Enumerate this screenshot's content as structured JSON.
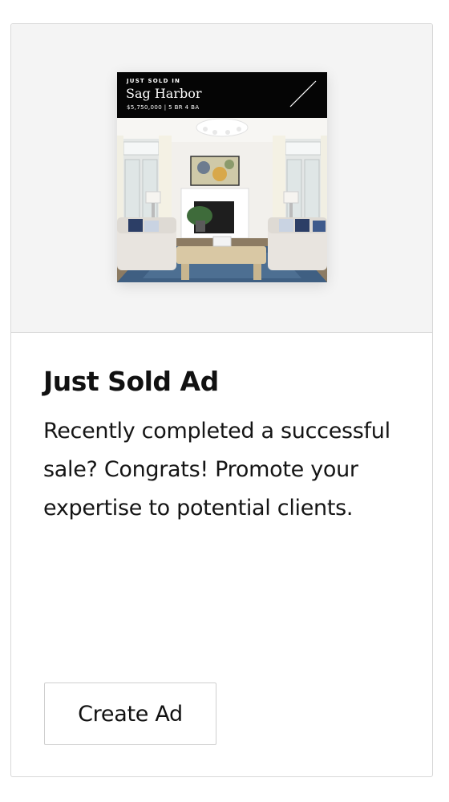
{
  "ad_preview": {
    "eyebrow": "JUST SOLD IN",
    "city": "Sag Harbor",
    "details": "$5,750,000 | 5 BR 4 BA"
  },
  "card": {
    "title": "Just Sold Ad",
    "description": "Recently completed a successful sale? Congrats! Promote your expertise to potential clients.",
    "button_label": "Create Ad"
  }
}
